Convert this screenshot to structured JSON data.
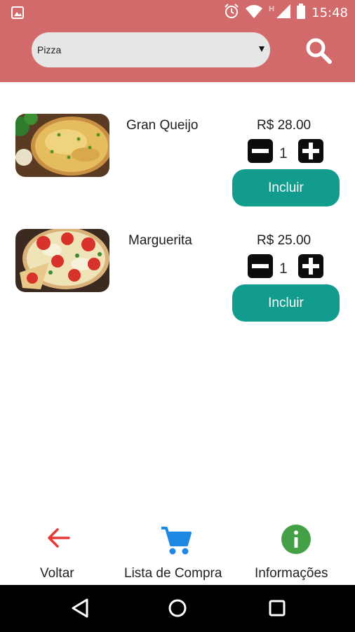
{
  "status_bar": {
    "time": "15:48",
    "network_label": "H",
    "icons": [
      "image-icon",
      "alarm-icon",
      "wifi-icon",
      "signal-icon",
      "battery-icon"
    ]
  },
  "header": {
    "category_select": {
      "value": "Pizza"
    },
    "search_icon": "search-icon"
  },
  "products": [
    {
      "name": "Gran Queijo",
      "price": "R$ 28.00",
      "quantity": "1",
      "include_label": "Incluir"
    },
    {
      "name": "Marguerita",
      "price": "R$ 25.00",
      "quantity": "1",
      "include_label": "Incluir"
    }
  ],
  "bottom_nav": {
    "back_label": "Voltar",
    "cart_label": "Lista de Compra",
    "info_label": "Informações"
  },
  "android_nav": {
    "icons": [
      "back-triangle-icon",
      "home-circle-icon",
      "recents-square-icon"
    ]
  },
  "colors": {
    "header": "#d2696b",
    "include_button": "#129c8e",
    "back_arrow": "#e53935",
    "cart": "#1e88e5",
    "info": "#43a047"
  }
}
